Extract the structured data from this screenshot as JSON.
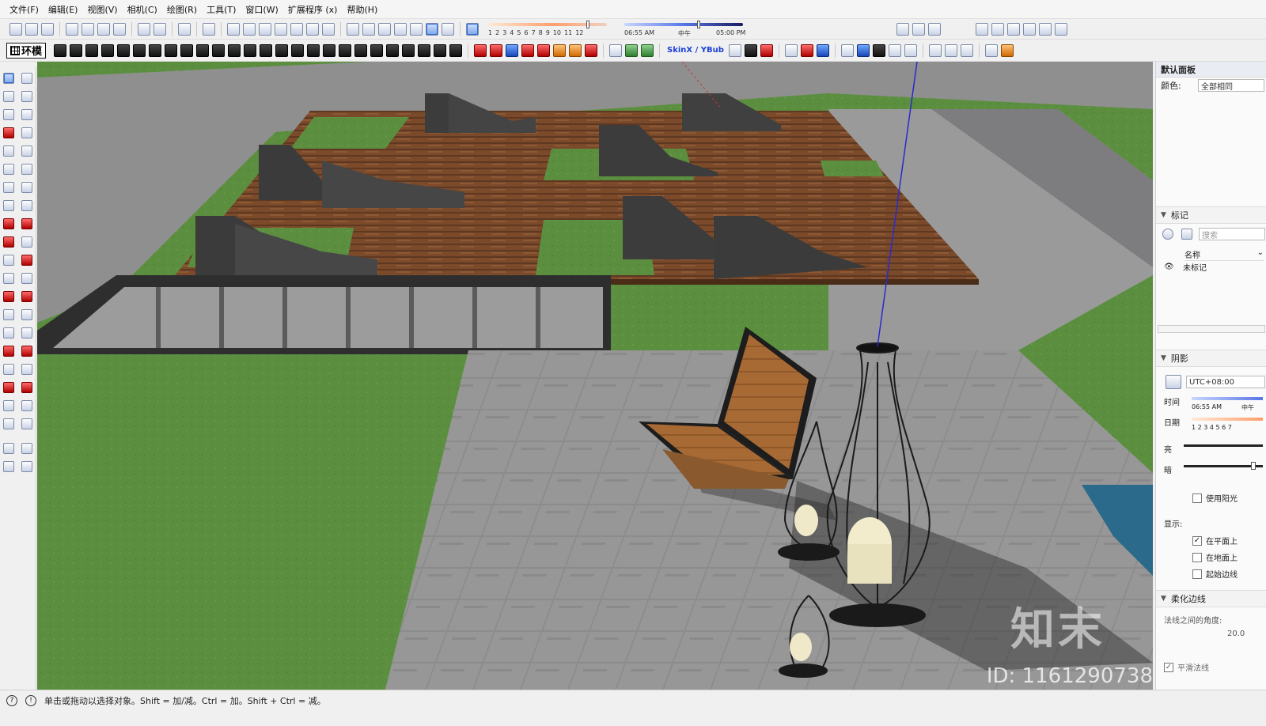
{
  "menubar": {
    "items": [
      "文件(F)",
      "编辑(E)",
      "视图(V)",
      "相机(C)",
      "绘图(R)",
      "工具(T)",
      "窗口(W)",
      "扩展程序 (x)",
      "帮助(H)"
    ]
  },
  "shadow_toolbar": {
    "months": [
      "1",
      "2",
      "3",
      "4",
      "5",
      "6",
      "7",
      "8",
      "9",
      "10",
      "11",
      "12"
    ],
    "time_start": "06:55 AM",
    "time_mid": "中午",
    "time_end": "05:00 PM"
  },
  "plugins": {
    "ground_logo": "环模",
    "skinx_label": "SkinX / YBub"
  },
  "right_panel": {
    "default_panel": {
      "title": "默认面板",
      "color_label": "颜色:",
      "color_value": "全部相同"
    },
    "tags": {
      "title": "标记",
      "search_placeholder": "搜索",
      "column_name": "名称",
      "items": [
        "未标记"
      ]
    },
    "shadows": {
      "title": "阴影",
      "timezone": "UTC+08:00",
      "time_label": "时间",
      "time_value": "06:55 AM",
      "time_mid": "中午",
      "date_label": "日期",
      "date_months": "1 2 3 4 5 6 7",
      "light_label": "亮",
      "dark_label": "暗",
      "use_sun_label": "使用阳光",
      "display_label": "显示:",
      "on_faces_label": "在平面上",
      "on_ground_label": "在地面上",
      "from_edges_label": "起始边线",
      "on_faces_checked": true,
      "on_ground_checked": false,
      "from_edges_checked": false,
      "use_sun_checked": false
    },
    "soften": {
      "title": "柔化边线",
      "angle_label": "法线之间的角度:",
      "angle_value": "20.0",
      "smooth_label": "平滑法线"
    }
  },
  "watermark": {
    "brand": "知末",
    "id_text": "ID: 1161290738"
  },
  "statusbar": {
    "message": "单击或拖动以选择对象。Shift = 加/减。Ctrl = 加。Shift + Ctrl = 减。"
  },
  "colors": {
    "grass": "#5b8f3f",
    "paving": "#8e8e8e",
    "wood_deck": "#7a4a2c",
    "bench_dark": "#3c3c3c",
    "chair_wood": "#a86a35"
  }
}
